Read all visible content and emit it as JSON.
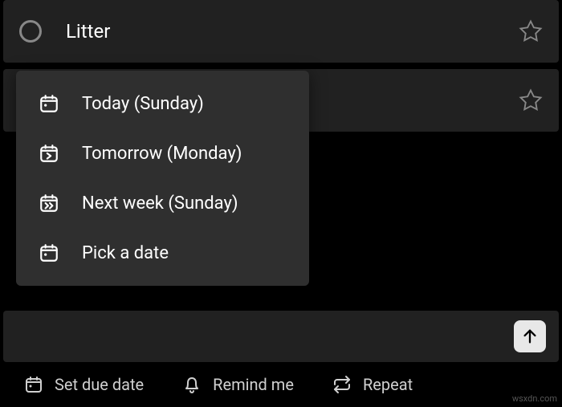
{
  "tasks": [
    {
      "title": "Litter"
    },
    {
      "title": ""
    }
  ],
  "dropdown": {
    "items": [
      {
        "label": "Today (Sunday)"
      },
      {
        "label": "Tomorrow (Monday)"
      },
      {
        "label": "Next week (Sunday)"
      },
      {
        "label": "Pick a date"
      }
    ]
  },
  "bottomBar": {
    "dueDate": "Set due date",
    "remind": "Remind me",
    "repeat": "Repeat"
  },
  "watermark": "wsxdn.com"
}
